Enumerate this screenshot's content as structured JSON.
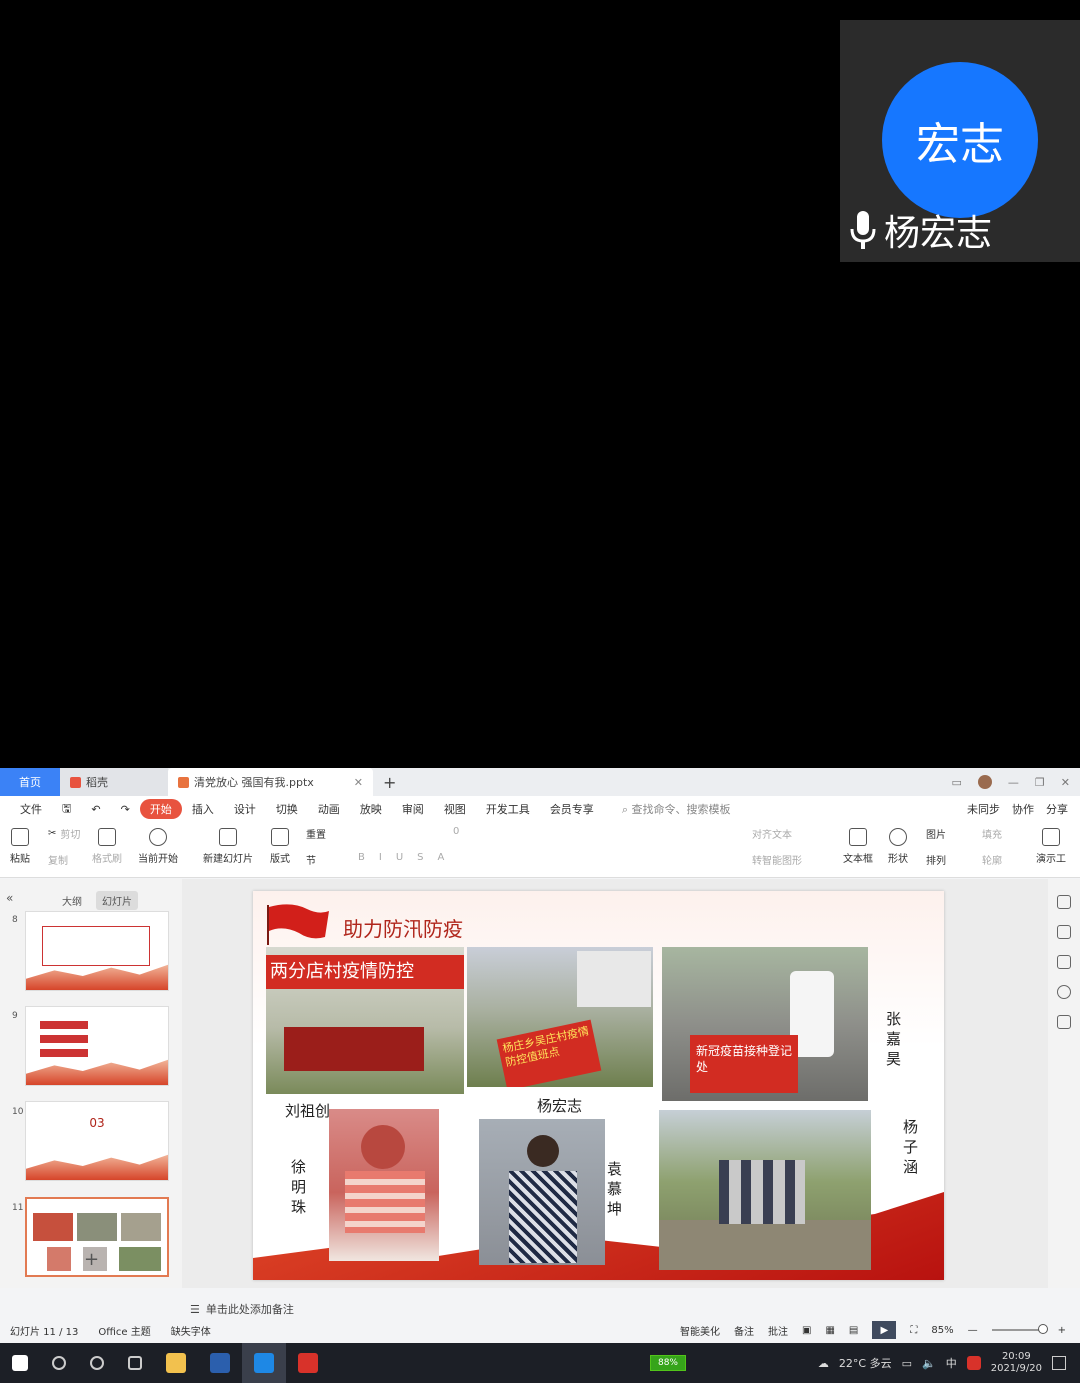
{
  "call": {
    "avatar_text": "宏志",
    "caller_name": "杨宏志"
  },
  "tabs": {
    "home": "首页",
    "daoke": "稻壳",
    "doc": "清党放心 强国有我.pptx",
    "new": "+"
  },
  "menu": {
    "file": "文件",
    "items": [
      "开始",
      "插入",
      "设计",
      "切换",
      "动画",
      "放映",
      "审阅",
      "视图",
      "开发工具",
      "会员专享"
    ],
    "search": "查找命令、搜索模板",
    "sync": "未同步",
    "collab": "协作",
    "share": "分享"
  },
  "ribbon": {
    "paste": "粘贴",
    "cut": "剪切",
    "copy": "复制",
    "format_painter": "格式刷",
    "from_current": "当前开始",
    "new_slide": "新建幻灯片",
    "layout": "版式",
    "reset": "重置",
    "section": "节",
    "font_size": "0",
    "align_text": "对齐文本",
    "smartart": "转智能图形",
    "textbox": "文本框",
    "shape": "形状",
    "picture": "图片",
    "arrange": "排列",
    "fill": "填充",
    "outline": "轮廓",
    "presenter": "演示工"
  },
  "panel": {
    "tab_outline": "大纲",
    "tab_slides": "幻灯片",
    "slide_numbers": [
      "8",
      "9",
      "10",
      "11"
    ],
    "thumb10_text": "03"
  },
  "slide": {
    "title": "助力防汛防疫",
    "banner_text": "两分店村疫情防控",
    "sign1": "杨庄乡吴庄村疫情防控值班点",
    "sign2": "新冠疫苗接种登记处",
    "captions": {
      "zhang": "张嘉昊",
      "liu": "刘祖创",
      "yang": "杨宏志",
      "xu": "徐明珠",
      "yuan": "袁慕坤",
      "yangzi": "杨子涵"
    }
  },
  "notes": "单击此处添加备注",
  "status": {
    "slide_counter": "幻灯片 11 / 13",
    "theme": "Office 主题",
    "missing_font": "缺失字体",
    "beautify": "智能美化",
    "remark": "备注",
    "comment": "批注",
    "zoom": "85%"
  },
  "taskbar": {
    "battery": "88%",
    "weather": "22°C 多云",
    "ime": "中",
    "time": "20:09",
    "date": "2021/9/20"
  },
  "colors": {
    "accent": "#e8533f",
    "brand_blue": "#1677ff",
    "slide_red": "#b0251b"
  }
}
